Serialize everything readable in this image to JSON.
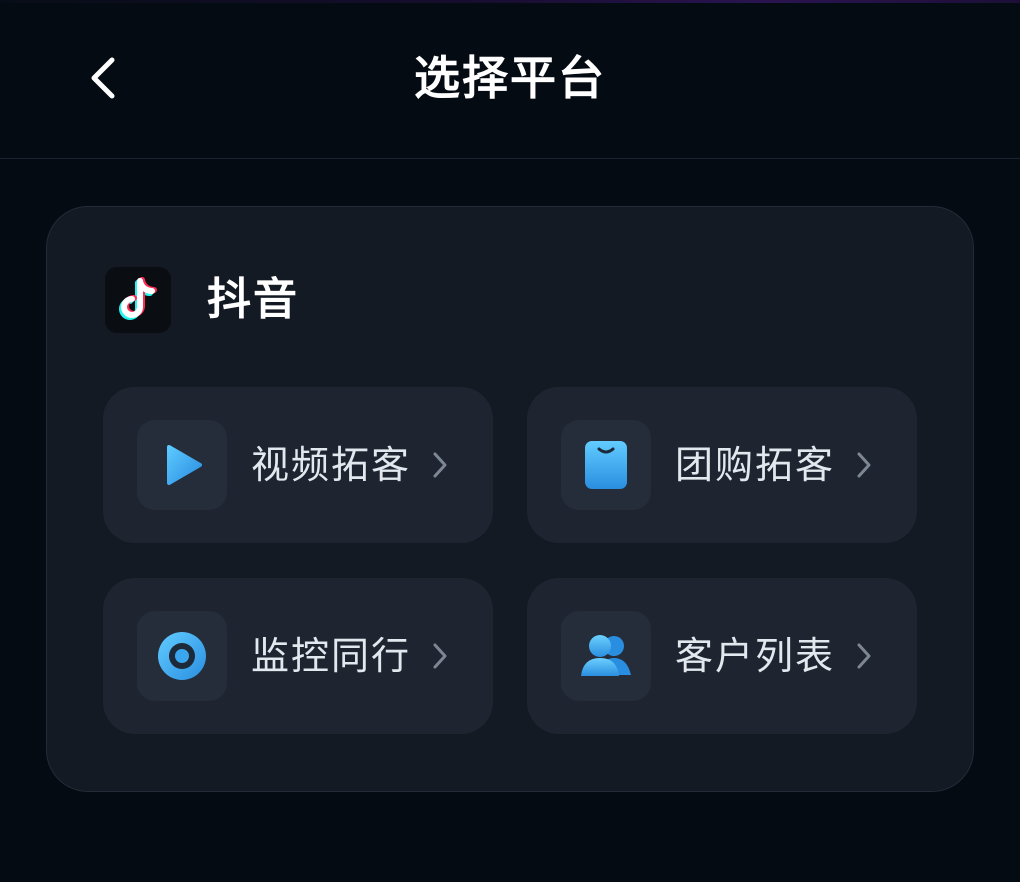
{
  "header": {
    "title": "选择平台",
    "back_icon": "chevron-left-icon"
  },
  "platform": {
    "name": "抖音",
    "logo_icon": "douyin-logo-icon",
    "tiles": [
      {
        "label": "视频拓客",
        "icon": "play-icon"
      },
      {
        "label": "团购拓客",
        "icon": "shopping-bag-icon"
      },
      {
        "label": "监控同行",
        "icon": "monitor-eye-icon"
      },
      {
        "label": "客户列表",
        "icon": "users-icon"
      }
    ]
  },
  "colors": {
    "background": "#050b13",
    "card": "#141a24",
    "tile": "#1e2531",
    "accent": "#3aa6ee"
  }
}
